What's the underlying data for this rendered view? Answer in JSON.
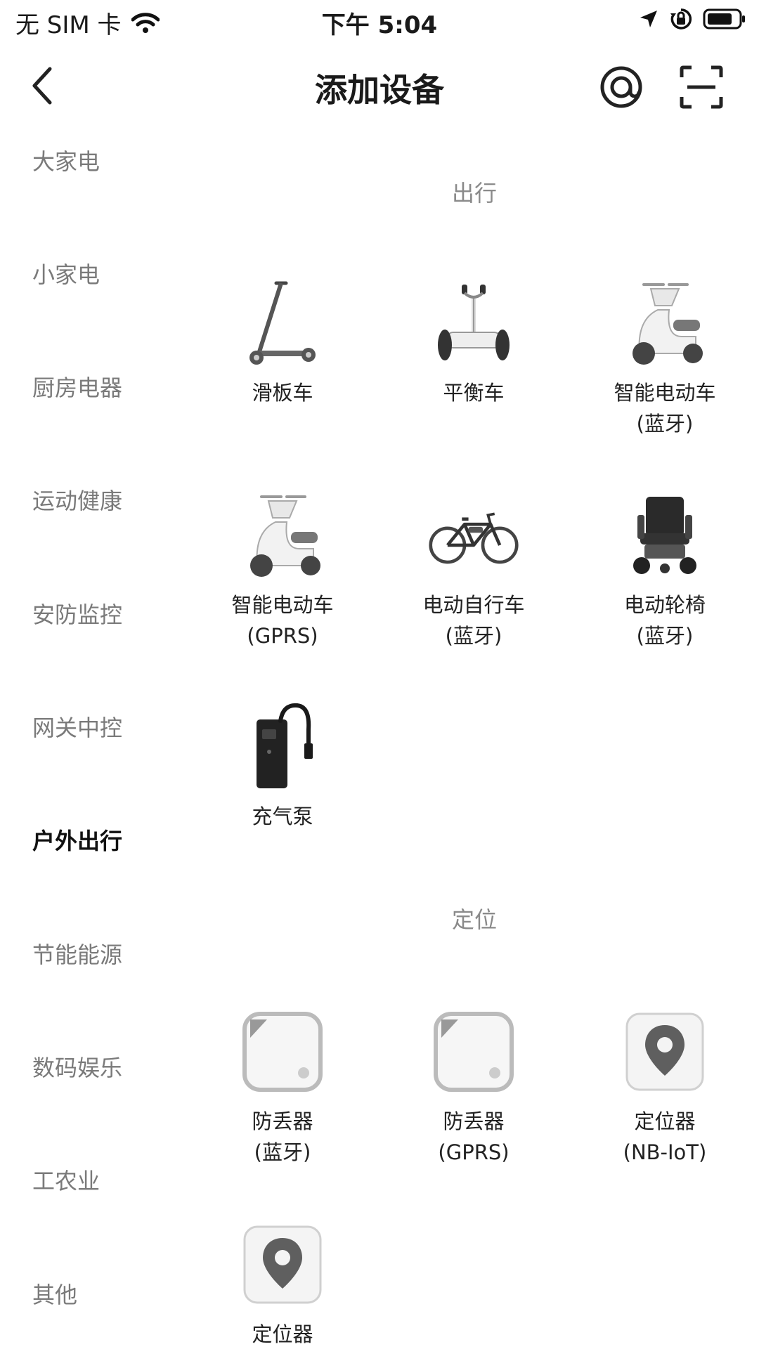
{
  "status_bar": {
    "carrier": "无 SIM 卡",
    "time": "下午 5:04",
    "icons": [
      "wifi-icon",
      "location-arrow-icon",
      "rotation-lock-icon",
      "battery-icon"
    ]
  },
  "nav": {
    "title": "添加设备",
    "icons": [
      "back-chevron-icon",
      "at-sign-icon",
      "scan-icon"
    ]
  },
  "sidebar": {
    "categories": [
      {
        "label": "大家电",
        "active": false
      },
      {
        "label": "小家电",
        "active": false
      },
      {
        "label": "厨房电器",
        "active": false
      },
      {
        "label": "运动健康",
        "active": false
      },
      {
        "label": "安防监控",
        "active": false
      },
      {
        "label": "网关中控",
        "active": false
      },
      {
        "label": "户外出行",
        "active": true
      },
      {
        "label": "节能能源",
        "active": false
      },
      {
        "label": "数码娱乐",
        "active": false
      },
      {
        "label": "工农业",
        "active": false
      },
      {
        "label": "其他",
        "active": false
      }
    ]
  },
  "sections": [
    {
      "title": "出行",
      "devices": [
        {
          "line1": "滑板车",
          "line2": "",
          "icon": "scooter-icon"
        },
        {
          "line1": "平衡车",
          "line2": "",
          "icon": "balance-scooter-icon"
        },
        {
          "line1": "智能电动车",
          "line2": "(蓝牙)",
          "icon": "e-moped-icon"
        },
        {
          "line1": "智能电动车",
          "line2": "(GPRS)",
          "icon": "e-moped-icon"
        },
        {
          "line1": "电动自行车",
          "line2": "(蓝牙)",
          "icon": "e-bike-icon"
        },
        {
          "line1": "电动轮椅",
          "line2": "(蓝牙)",
          "icon": "wheelchair-icon"
        },
        {
          "line1": "充气泵",
          "line2": "",
          "icon": "air-pump-icon"
        }
      ]
    },
    {
      "title": "定位",
      "devices": [
        {
          "line1": "防丢器",
          "line2": "(蓝牙)",
          "icon": "anti-loss-tag-icon"
        },
        {
          "line1": "防丢器",
          "line2": "(GPRS)",
          "icon": "anti-loss-tag-icon"
        },
        {
          "line1": "定位器",
          "line2": "(NB-IoT)",
          "icon": "locator-pin-icon"
        },
        {
          "line1": "定位器",
          "line2": "",
          "icon": "locator-pin-icon"
        }
      ]
    }
  ]
}
